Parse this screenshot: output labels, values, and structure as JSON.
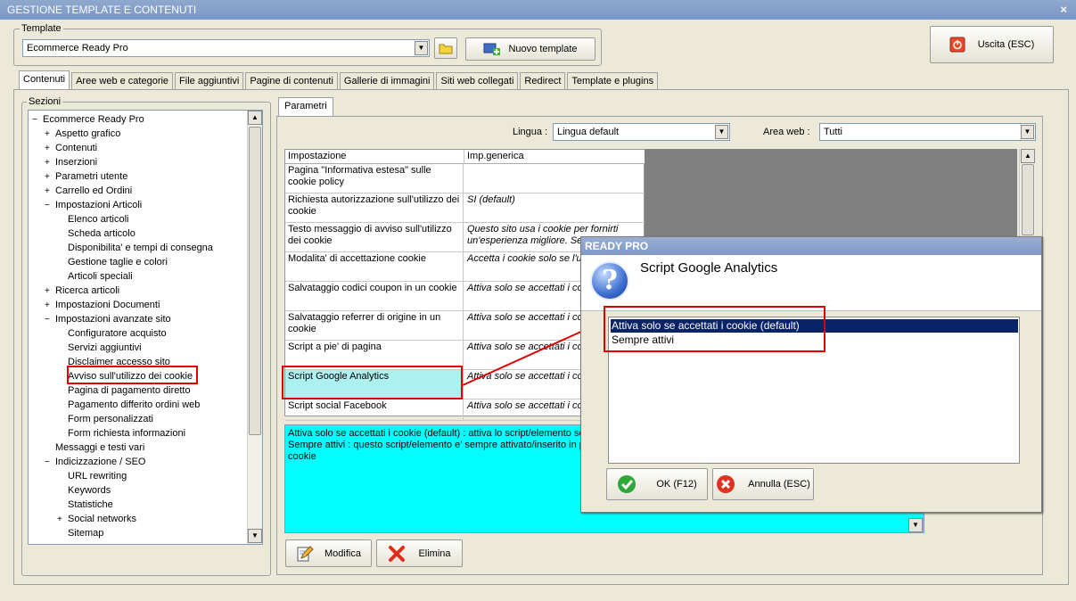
{
  "window": {
    "title": "GESTIONE TEMPLATE E CONTENUTI",
    "close_glyph": "×"
  },
  "template": {
    "legend": "Template",
    "selected": "Ecommerce Ready Pro",
    "new_label": "Nuovo template"
  },
  "exit_label": "Uscita (ESC)",
  "tabs": [
    "Contenuti",
    "Aree web e categorie",
    "File aggiuntivi",
    "Pagine di contenuti",
    "Gallerie di immagini",
    "Siti web collegati",
    "Redirect",
    "Template e plugins"
  ],
  "sections": {
    "legend": "Sezioni",
    "tree": [
      {
        "label": "Ecommerce Ready Pro",
        "level": 0,
        "pm": "−"
      },
      {
        "label": "Aspetto grafico",
        "level": 1,
        "pm": "+"
      },
      {
        "label": "Contenuti",
        "level": 1,
        "pm": "+"
      },
      {
        "label": "Inserzioni",
        "level": 1,
        "pm": "+"
      },
      {
        "label": "Parametri utente",
        "level": 1,
        "pm": "+"
      },
      {
        "label": "Carrello ed Ordini",
        "level": 1,
        "pm": "+"
      },
      {
        "label": "Impostazioni Articoli",
        "level": 1,
        "pm": "−"
      },
      {
        "label": "Elenco articoli",
        "level": 2,
        "pm": ""
      },
      {
        "label": "Scheda articolo",
        "level": 2,
        "pm": ""
      },
      {
        "label": "Disponibilita' e tempi di consegna",
        "level": 2,
        "pm": ""
      },
      {
        "label": "Gestione taglie e colori",
        "level": 2,
        "pm": ""
      },
      {
        "label": "Articoli speciali",
        "level": 2,
        "pm": ""
      },
      {
        "label": "Ricerca articoli",
        "level": 1,
        "pm": "+"
      },
      {
        "label": "Impostazioni Documenti",
        "level": 1,
        "pm": "+"
      },
      {
        "label": "Impostazioni avanzate sito",
        "level": 1,
        "pm": "−"
      },
      {
        "label": "Configuratore acquisto",
        "level": 2,
        "pm": ""
      },
      {
        "label": "Servizi aggiuntivi",
        "level": 2,
        "pm": ""
      },
      {
        "label": "Disclaimer accesso sito",
        "level": 2,
        "pm": ""
      },
      {
        "label": "Avviso sull'utilizzo dei cookie",
        "level": 2,
        "pm": ""
      },
      {
        "label": "Pagina di pagamento diretto",
        "level": 2,
        "pm": ""
      },
      {
        "label": "Pagamento differito ordini web",
        "level": 2,
        "pm": ""
      },
      {
        "label": "Form personalizzati",
        "level": 2,
        "pm": ""
      },
      {
        "label": "Form richiesta informazioni",
        "level": 2,
        "pm": ""
      },
      {
        "label": "Messaggi e testi vari",
        "level": 1,
        "pm": ""
      },
      {
        "label": "Indicizzazione / SEO",
        "level": 1,
        "pm": "−"
      },
      {
        "label": "URL rewriting",
        "level": 2,
        "pm": ""
      },
      {
        "label": "Keywords",
        "level": 2,
        "pm": ""
      },
      {
        "label": "Statistiche",
        "level": 2,
        "pm": ""
      },
      {
        "label": "Social networks",
        "level": 2,
        "pm": "+"
      },
      {
        "label": "Sitemap",
        "level": 2,
        "pm": ""
      }
    ]
  },
  "params": {
    "tab": "Parametri",
    "lingua_label": "Lingua :",
    "lingua_value": "Lingua default",
    "area_label": "Area web :",
    "area_value": "Tutti",
    "col1": "Impostazione",
    "col2": "Imp.generica",
    "rows": [
      {
        "name": "Pagina \"Informativa estesa\" sulle cookie policy",
        "value": ""
      },
      {
        "name": "Richiesta autorizzazione sull'utilizzo dei cookie",
        "value": "SI (default)"
      },
      {
        "name": "Testo messaggio di avviso sull'utilizzo dei cookie",
        "value": "Questo sito usa i cookie per fornirti un'esperienza migliore. Se"
      },
      {
        "name": "Modalita' di accettazione cookie",
        "value": "Accetta i cookie solo se l'ut OK (default)"
      },
      {
        "name": "Salvataggio codici coupon in un cookie",
        "value": "Attiva solo se accettati i co"
      },
      {
        "name": "Salvataggio referrer di origine in un cookie",
        "value": "Attiva solo se accettati i co"
      },
      {
        "name": "Script a pie' di pagina",
        "value": "Attiva solo se accettati i co"
      },
      {
        "name": "Script Google Analytics",
        "value": "Attiva solo se accettati i co"
      },
      {
        "name": "Script social Facebook",
        "value": "Attiva solo se accettati i co"
      }
    ],
    "description_line1": "Attiva solo se accettati i cookie (default) : attiva lo script/elemento so",
    "description_line2": "Sempre attivi : questo script/elemento e' sempre attivato/inserito in p",
    "description_line3": "cookie",
    "modify_label": "Modifica",
    "delete_label": "Elimina"
  },
  "dialog": {
    "title": "READY PRO",
    "heading": "Script Google Analytics",
    "options": [
      "Attiva solo se accettati i cookie (default)",
      "Sempre attivi"
    ],
    "ok_label": "OK (F12)",
    "cancel_label": "Annulla (ESC)"
  }
}
